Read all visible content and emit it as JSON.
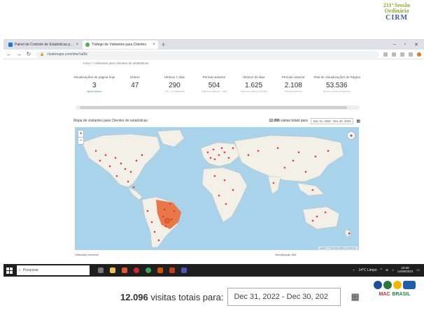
{
  "slide": {
    "logo": {
      "line1": "211ª Sessão",
      "line2": "Ordinária",
      "line3": "CIRM"
    },
    "bottom_logos": {
      "text_a": "MAC",
      "text_b": "BRASIL"
    }
  },
  "browser": {
    "tabs": [
      {
        "label": "Painel de Controle de Estatísticas para Sites",
        "active": false
      },
      {
        "label": "Tráfego de Visitantes para Clientes",
        "active": true
      }
    ],
    "url": "clustrmaps.com/site/1a0fx",
    "breadcrumb": "Início > Visitantes para Clientes de estatísticas"
  },
  "stats": [
    {
      "label": "Visualizações de página hoje",
      "value": "3",
      "sub": "agora mesmo",
      "sub_green": true
    },
    {
      "label": "Ontem",
      "value": "47",
      "sub": "",
      "sub_green": false
    },
    {
      "label": "Últimos 7 dias",
      "value": "290",
      "sub": "1.5 / 1.0 visitantes",
      "sub_green": false
    },
    {
      "label": "Período anterior",
      "value": "504",
      "sub": "Total nos últimos 7 dias",
      "sub_green": false
    },
    {
      "label": "Últimos 30 dias",
      "value": "1.625",
      "sub": "Total nos últimos 30 dias",
      "sub_green": false
    },
    {
      "label": "Período anterior",
      "value": "2.108",
      "sub": "Período anterior",
      "sub_green": false
    },
    {
      "label": "Total de Visualizações de Página",
      "value": "53.536",
      "sub": "Desde o início do serviço",
      "sub_green": false
    }
  ],
  "map": {
    "title": "Mapa de visitantes para Clientes de estatísticas",
    "visits_count": "12.096",
    "visits_label": "visitas totais para",
    "date_range_small": "Dec 31, 2022 - Dec 30, 2023",
    "attribution": "Leaflet | © OpenStreetMap contributors",
    "footer_left": "Visitantes recentes",
    "footer_mid": "Visualização",
    "footer_mid2": "365",
    "ocean_color": "#a8d3ea",
    "land_color": "#f3f0e8",
    "dot_color": "#e53935",
    "brazil_color": "#e8622c"
  },
  "taskbar": {
    "search_placeholder": "Pesquisar",
    "weather": "14°C Limpo",
    "time": "23:08",
    "date": "14/06/2023"
  },
  "caption": {
    "count": "12.096",
    "label": "visitas totais para:",
    "date_range": "Dec 31, 2022 - Dec 30, 202"
  }
}
